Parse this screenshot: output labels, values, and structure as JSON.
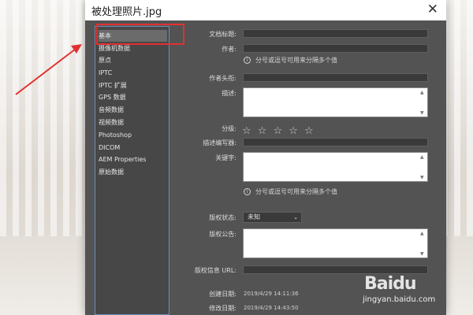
{
  "dialog": {
    "title": "被处理照片.jpg",
    "close_glyph": "✕"
  },
  "sidebar": {
    "items": [
      {
        "label": "基本",
        "active": true
      },
      {
        "label": "摄像机数据"
      },
      {
        "label": "原点"
      },
      {
        "label": "IPTC"
      },
      {
        "label": "IPTC 扩展"
      },
      {
        "label": "GPS 数据"
      },
      {
        "label": "音频数据"
      },
      {
        "label": "视频数据"
      },
      {
        "label": "Photoshop"
      },
      {
        "label": "DICOM"
      },
      {
        "label": "AEM Properties"
      },
      {
        "label": "原始数据"
      }
    ]
  },
  "form": {
    "doc_title_label": "文档标题:",
    "doc_title_value": "",
    "author_label": "作者:",
    "author_value": "",
    "author_hint": "分号或逗号可用来分隔多个值",
    "author_title_label": "作者头衔:",
    "author_title_value": "",
    "description_label": "描述:",
    "description_value": "",
    "rating_label": "分级:",
    "rating_value": 0,
    "rating_max": 5,
    "description_writer_label": "描述编写器:",
    "description_writer_value": "",
    "keywords_label": "关键字:",
    "keywords_value": "",
    "keywords_hint": "分号或逗号可用来分隔多个值",
    "copyright_status_label": "版权状态:",
    "copyright_status_value": "未知",
    "copyright_notice_label": "版权公告:",
    "copyright_notice_value": "",
    "copyright_url_label": "版权信息 URL:",
    "copyright_url_value": "",
    "created_label": "创建日期:",
    "created_value": "2019/4/29 14:11:36",
    "modified_label": "修改日期:",
    "modified_value": "2019/4/29 14:43:50"
  },
  "icons": {
    "info": "i",
    "star": "☆",
    "chevron": "⌄",
    "scroll_up": "▲",
    "scroll_down": "▼"
  },
  "watermark": {
    "logo": "Baidu",
    "site": "jingyan.baidu.com"
  },
  "colors": {
    "dialog_bg": "#535353",
    "sidebar_bg": "#474747",
    "active_item": "#6b6b6b",
    "annotation_red": "#e23030"
  }
}
